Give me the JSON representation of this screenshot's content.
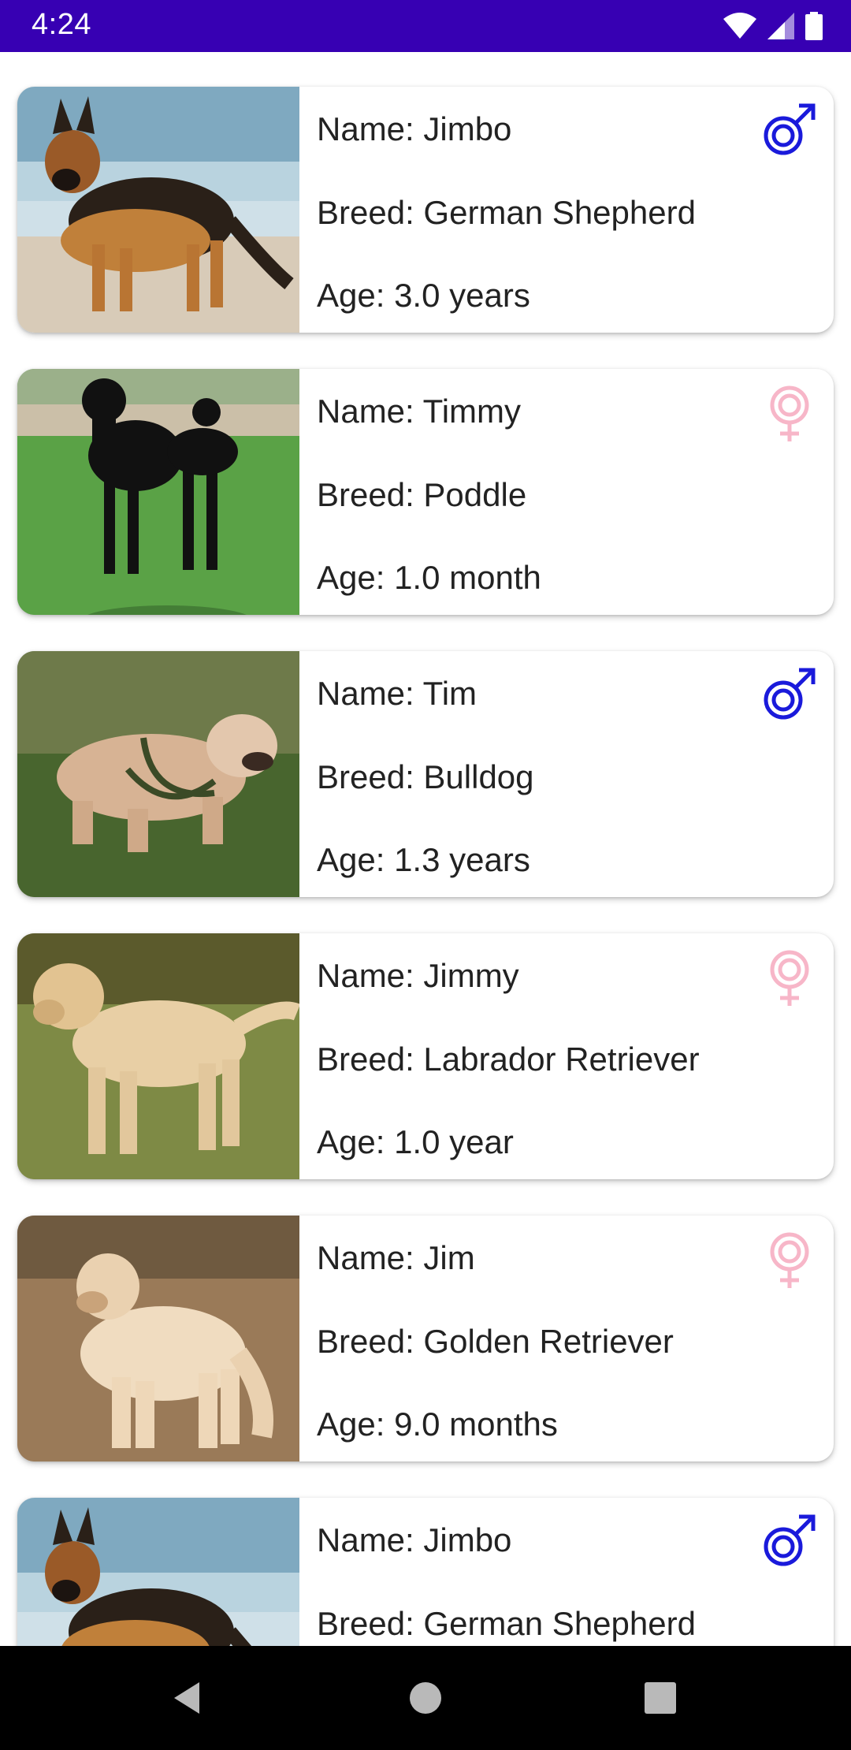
{
  "status_bar": {
    "time": "4:24",
    "icons": [
      "wifi-icon",
      "cellular-signal-icon",
      "battery-icon"
    ],
    "background": "#3700B3"
  },
  "dogs": [
    {
      "name": "Name: Jimbo",
      "breed": "Breed: German Shepherd",
      "age": "Age: 3.0 years",
      "gender": "male",
      "photo": "german-shepherd-photo"
    },
    {
      "name": "Name: Timmy",
      "breed": "Breed: Poddle",
      "age": "Age: 1.0 month",
      "gender": "female",
      "photo": "poodle-photo"
    },
    {
      "name": "Name: Tim",
      "breed": "Breed: Bulldog",
      "age": "Age: 1.3 years",
      "gender": "male",
      "photo": "bulldog-photo"
    },
    {
      "name": "Name: Jimmy",
      "breed": "Breed: Labrador Retriever",
      "age": "Age: 1.0 year",
      "gender": "female",
      "photo": "labrador-photo"
    },
    {
      "name": "Name: Jim",
      "breed": "Breed: Golden Retriever",
      "age": "Age: 9.0 months",
      "gender": "female",
      "photo": "golden-retriever-photo"
    },
    {
      "name": "Name: Jimbo",
      "breed": "Breed: German Shepherd",
      "age": "",
      "gender": "male",
      "photo": "german-shepherd-photo"
    }
  ],
  "colors": {
    "male": "#1A1ADB",
    "female": "#F7B6C8"
  },
  "nav_bar": {
    "buttons": [
      "back-icon",
      "home-icon",
      "recents-icon"
    ]
  }
}
